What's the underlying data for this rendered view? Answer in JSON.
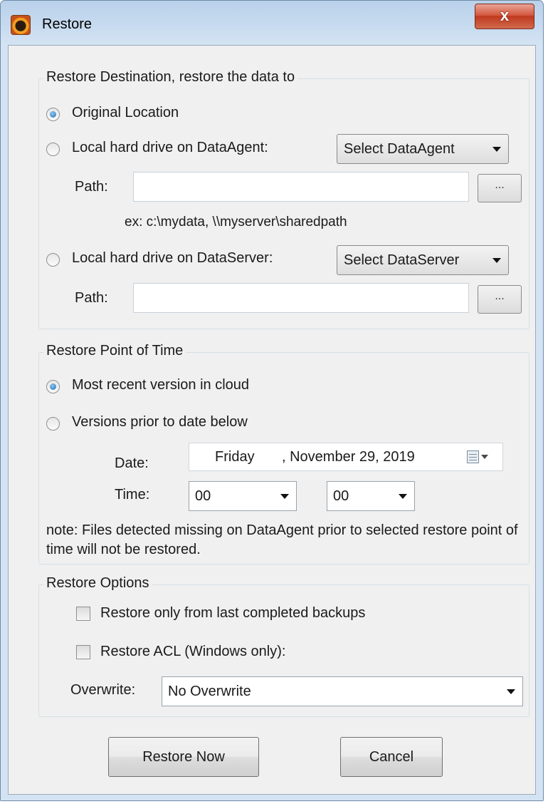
{
  "window": {
    "title": "Restore",
    "close_glyph": "x"
  },
  "destination": {
    "group_title": "Restore Destination, restore the data to",
    "original_location": {
      "label": "Original Location",
      "selected": true
    },
    "dataagent": {
      "label": "Local hard drive on DataAgent:",
      "selected": false,
      "select_value": "Select DataAgent",
      "path_label": "Path:",
      "path_value": "",
      "browse_label": "...",
      "example": "ex: c:\\mydata, \\\\myserver\\sharedpath"
    },
    "dataserver": {
      "label": "Local hard drive on DataServer:",
      "selected": false,
      "select_value": "Select DataServer",
      "path_label": "Path:",
      "path_value": "",
      "browse_label": "..."
    }
  },
  "point_of_time": {
    "group_title": "Restore Point of Time",
    "most_recent": {
      "label": "Most recent version in cloud",
      "selected": true
    },
    "prior_versions": {
      "label": "Versions prior to date below",
      "selected": false
    },
    "date_label": "Date:",
    "date_day": "Friday",
    "date_rest": ", November 29, 2019",
    "time_label": "Time:",
    "hour": "00",
    "minute": "00",
    "note": "note: Files detected missing on DataAgent prior to selected restore point of time will not be restored."
  },
  "options": {
    "group_title": "Restore Options",
    "last_completed": {
      "label": "Restore only from last completed backups",
      "checked": false
    },
    "restore_acl": {
      "label": "Restore ACL (Windows only):",
      "checked": false
    },
    "overwrite_label": "Overwrite:",
    "overwrite_value": "No Overwrite"
  },
  "buttons": {
    "restore_now": "Restore Now",
    "cancel": "Cancel"
  },
  "icons": {
    "app": "app-logo-icon",
    "close": "close-icon",
    "calendar": "calendar-icon"
  }
}
